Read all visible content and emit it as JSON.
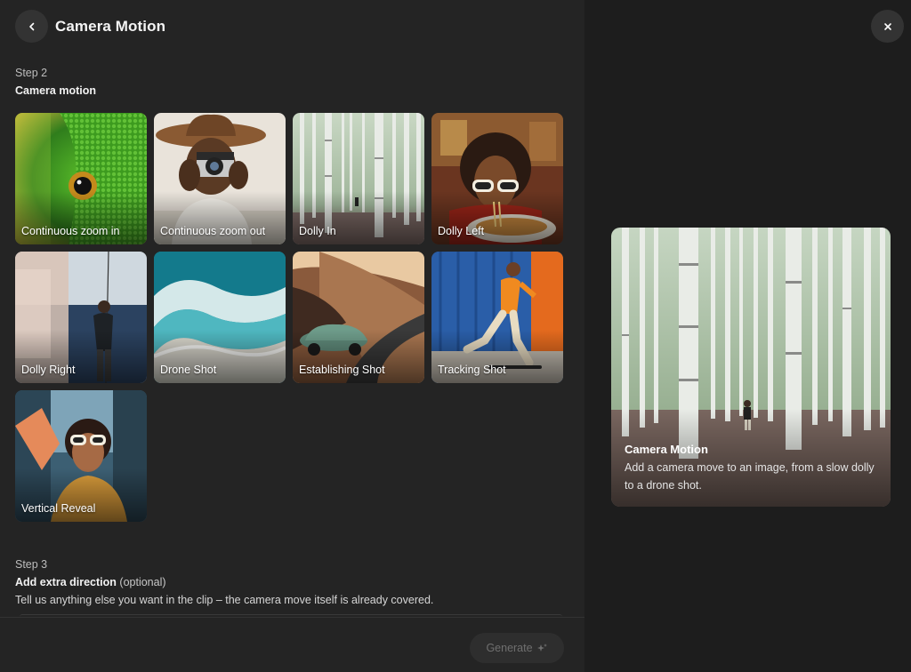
{
  "header": {
    "title": "Camera Motion",
    "back_icon": "chevron-left-icon"
  },
  "step2": {
    "label": "Step 2",
    "title": "Camera motion"
  },
  "motions": [
    {
      "label": "Continuous zoom in",
      "art": "green-lizard-eye"
    },
    {
      "label": "Continuous zoom out",
      "art": "man-hat-camera"
    },
    {
      "label": "Dolly In",
      "art": "birch-forest"
    },
    {
      "label": "Dolly Left",
      "art": "woman-sunglasses-noodles"
    },
    {
      "label": "Dolly Right",
      "art": "man-fishing-sea"
    },
    {
      "label": "Drone Shot",
      "art": "ocean-waves-aerial"
    },
    {
      "label": "Establishing Shot",
      "art": "vintage-car-coast-road"
    },
    {
      "label": "Tracking Shot",
      "art": "skateboarder-container"
    },
    {
      "label": "Vertical Reveal",
      "art": "woman-sunglasses-city"
    }
  ],
  "step3": {
    "label": "Step 3",
    "title": "Add extra direction",
    "optional": "(optional)",
    "helper": "Tell us anything else you want in the clip – the camera move itself is already covered."
  },
  "generate": {
    "label": "Generate",
    "icon": "sparkle-icon",
    "enabled": false
  },
  "preview": {
    "title": "Camera Motion",
    "description": "Add a camera move to an image, from a slow dolly to a drone shot.",
    "art": "birch-forest"
  },
  "close_icon": "close-icon",
  "colors": {
    "panel_left": "#242424",
    "panel_right": "#1d1d1d",
    "button_bg": "#333333",
    "disabled_text": "#6f6f6f"
  }
}
